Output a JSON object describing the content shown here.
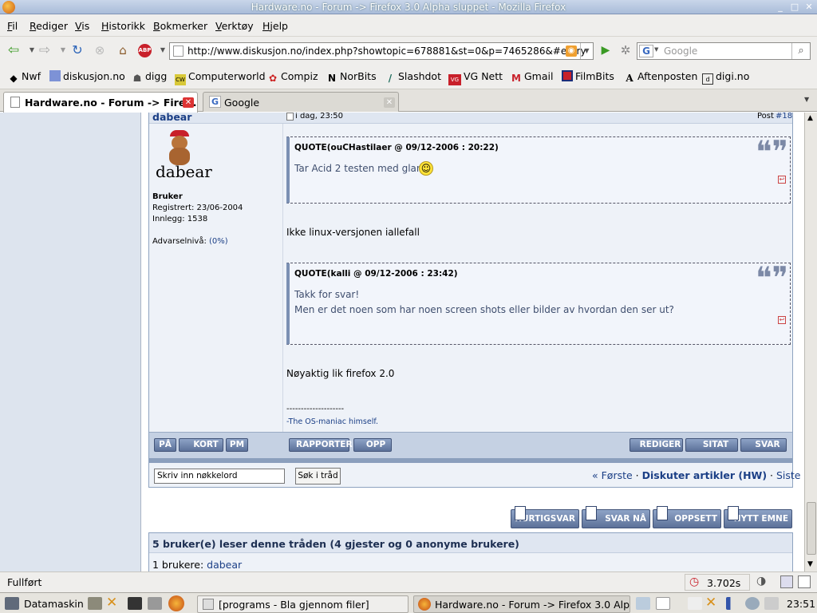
{
  "window": {
    "title": "Hardware.no - Forum -> Firefox 3.0 Alpha sluppet - Mozilla Firefox"
  },
  "menu": [
    "Fil",
    "Rediger",
    "Vis",
    "Historikk",
    "Bokmerker",
    "Verktøy",
    "Hjelp"
  ],
  "nav": {
    "url": "http://www.diskusjon.no/index.php?showtopic=678881&st=0&p=7465286&#entry",
    "search_placeholder": "Google",
    "search_engine_letter": "G"
  },
  "bookmarks": [
    "Nwf",
    "diskusjon.no",
    "digg",
    "Computerworld",
    "Compiz",
    "NorBits",
    "Slashdot",
    "VG Nett",
    "Gmail",
    "FilmBits",
    "Aftenposten",
    "digi.no"
  ],
  "tabs": [
    {
      "label": "Hardware.no - Forum -> Firef..."
    },
    {
      "label": "Google"
    }
  ],
  "post": {
    "author": "dabear",
    "date": "i dag, 23:50",
    "post_label": "Post ",
    "post_number": "#18",
    "avatar_text": "dabear",
    "group": "Bruker",
    "registered": "Registrert: 23/06-2004",
    "posts": "Innlegg: 1538",
    "warn_label": "Advarselnivå: ",
    "warn_value": "(0%)",
    "quote1": {
      "header": "QUOTE(ouCHastilaer @ 09/12-2006 : 20:22)",
      "lines": [
        "Tar Acid 2 testen med glans"
      ]
    },
    "reply1": "Ikke linux-versjonen iallefall",
    "quote2": {
      "header": "QUOTE(kalli @ 09/12-2006 : 23:42)",
      "lines": [
        "Takk for svar!",
        "Men er det noen som har noen screen shots eller bilder av hvordan den ser ut?"
      ]
    },
    "reply2": "Nøyaktig lik firefox 2.0",
    "sig_sep": "--------------------",
    "signature": "-The OS-maniac himself.",
    "left_buttons": [
      "PÅ",
      "KORT",
      "PM"
    ],
    "mid_buttons": [
      "RAPPORTER",
      "OPP"
    ],
    "right_buttons": [
      "REDIGER",
      "SITAT",
      "SVAR"
    ]
  },
  "topicbar": {
    "search_value": "Skriv inn nøkkelord",
    "search_button": "Søk i tråd",
    "first": "« Første",
    "sep": " · ",
    "forum": "Diskuter artikler (HW)",
    "last": "Siste »"
  },
  "bigbuttons": [
    "HURTIGSVAR",
    "SVAR NÅ",
    "OPPSETT",
    "NYTT EMNE"
  ],
  "readers": {
    "title": "5 bruker(e) leser denne tråden (4 gjester og 0 anonyme brukere)",
    "members_label": "1 brukere: ",
    "member": "dabear"
  },
  "status": {
    "text": "Fullført",
    "timing": "3.702s"
  },
  "taskbar": {
    "start": "Datamaskin",
    "tasks": [
      "[programs - Bla gjennom filer]",
      "Hardware.no - Forum -> Firefox 3.0 Alp..."
    ],
    "clock": "23:51"
  }
}
